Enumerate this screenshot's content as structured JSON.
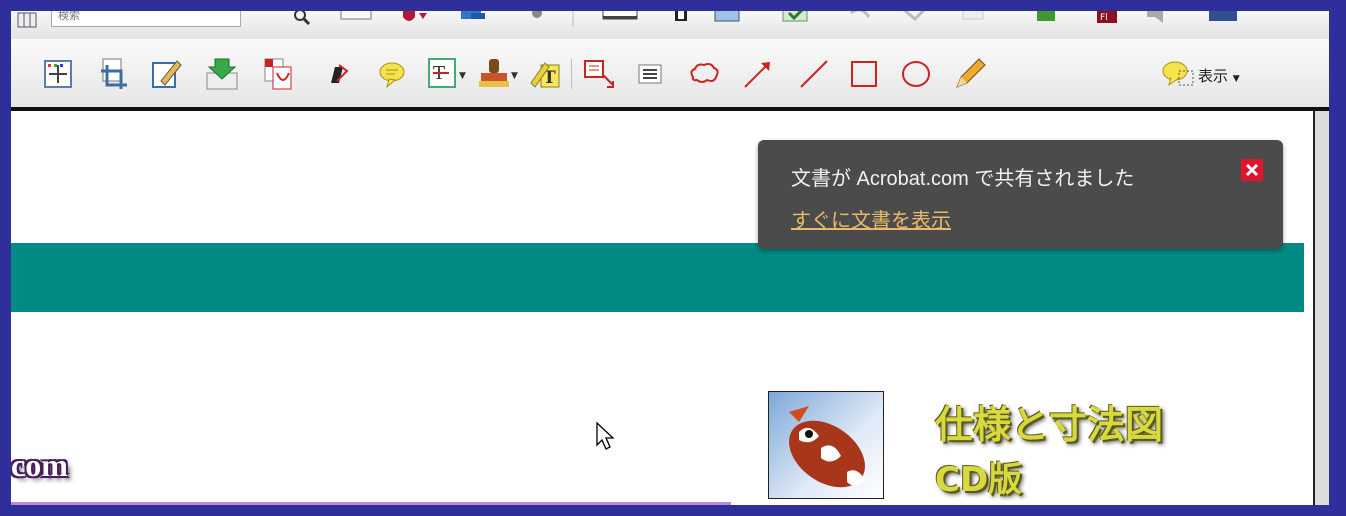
{
  "toolbar_top": {
    "search_placeholder": "検索"
  },
  "toolbar_main": {
    "tools": [
      {
        "icon": "select-object-icon"
      },
      {
        "icon": "crop-icon"
      },
      {
        "icon": "edit-document-icon"
      },
      {
        "icon": "import-icon"
      },
      {
        "icon": "pdf-convert-icon"
      },
      {
        "icon": "redact-icon"
      },
      {
        "icon": "sticky-note-icon"
      },
      {
        "icon": "text-edit-icon"
      },
      {
        "icon": "stamp-icon"
      },
      {
        "icon": "highlight-text-icon"
      },
      {
        "icon": "text-callout-icon"
      },
      {
        "icon": "text-box-icon"
      },
      {
        "icon": "cloud-icon"
      },
      {
        "icon": "arrow-icon"
      },
      {
        "icon": "line-icon"
      },
      {
        "icon": "rectangle-icon"
      },
      {
        "icon": "oval-icon"
      },
      {
        "icon": "pencil-icon"
      },
      {
        "icon": "show-comments-icon"
      }
    ],
    "display_label": "表示"
  },
  "notification": {
    "message": "文書が Acrobat.com で共有されました",
    "link": "すぐに文書を表示"
  },
  "content": {
    "com_text": "com",
    "product_title": "仕様と寸法図",
    "product_sub": "CD版"
  },
  "colors": {
    "frame": "#2f2f9c",
    "teal_band": "#008b85",
    "notification_bg": "#4b4b4b",
    "notification_link": "#e8b96b",
    "close_red": "#e2142d",
    "product_title": "#d7d93f"
  }
}
